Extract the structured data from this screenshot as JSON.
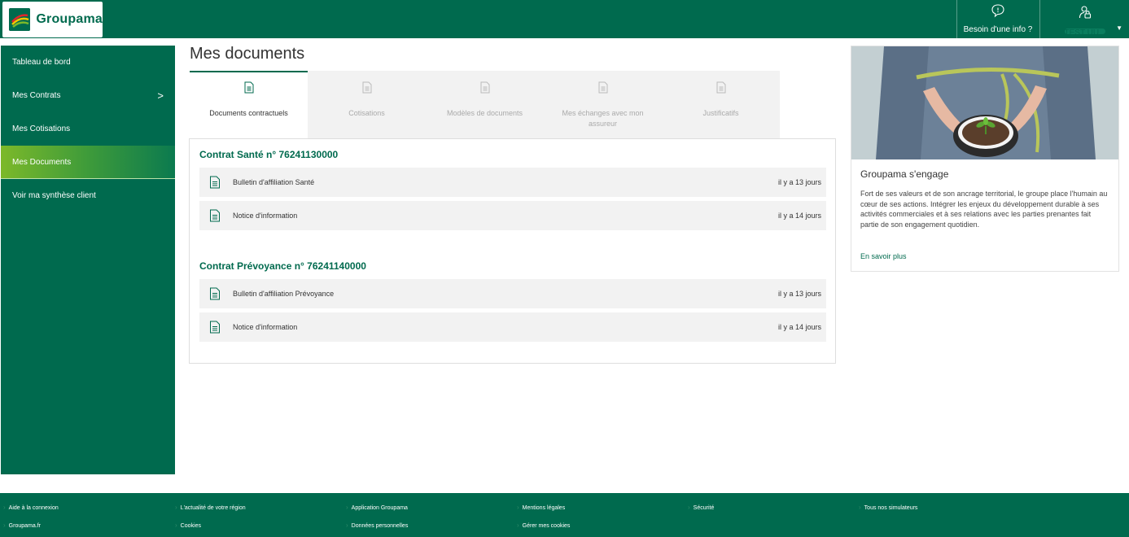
{
  "brand": {
    "name": "Groupama",
    "color": "#006a4e",
    "accent": "#7cb92a"
  },
  "header": {
    "help_label": "Besoin d'une info ?",
    "help_icon": "chat-bubble-icon",
    "user_icon": "user-icon",
    "user_name": "TEST UU"
  },
  "sidebar": {
    "items": [
      {
        "label": "Tableau de bord"
      },
      {
        "label": "Mes Contrats",
        "chevron": ">"
      },
      {
        "label": "Mes Cotisations"
      },
      {
        "label": "Mes Documents",
        "active": true
      },
      {
        "label": "Voir ma synthèse client"
      }
    ]
  },
  "main": {
    "title": "Mes documents",
    "tabs": [
      {
        "label": "Documents contractuels",
        "active": true
      },
      {
        "label": "Cotisations"
      },
      {
        "label": "Modèles de documents"
      },
      {
        "label": "Mes échanges avec mon assureur"
      },
      {
        "label": "Justificatifs"
      }
    ],
    "contracts": [
      {
        "title": "Contrat Santé n° 76241130000",
        "documents": [
          {
            "name": "Bulletin d'affiliation Santé",
            "date": "il y a 13 jours"
          },
          {
            "name": "Notice d'information",
            "date": "il y a 14 jours"
          }
        ]
      },
      {
        "title": "Contrat Prévoyance n° 76241140000",
        "documents": [
          {
            "name": "Bulletin d'affiliation Prévoyance",
            "date": "il y a 13 jours"
          },
          {
            "name": "Notice d'information",
            "date": "il y a 14 jours"
          }
        ]
      }
    ]
  },
  "promo": {
    "title": "Groupama s'engage",
    "text": "Fort de ses valeurs et de son ancrage territorial, le groupe place l'humain au cœur de ses actions. Intégrer les enjeux du développement durable à ses activités commerciales et à ses relations avec les parties prenantes fait partie de son engagement quotidien.",
    "link": "En savoir plus"
  },
  "footer": {
    "row1": [
      "Aide à la connexion",
      "L'actualité de votre région",
      "Application Groupama",
      "Mentions légales",
      "Sécurité",
      "Tous nos simulateurs"
    ],
    "row2": [
      "Groupama.fr",
      "Cookies",
      "Données personnelles",
      "Gérer mes cookies"
    ]
  }
}
